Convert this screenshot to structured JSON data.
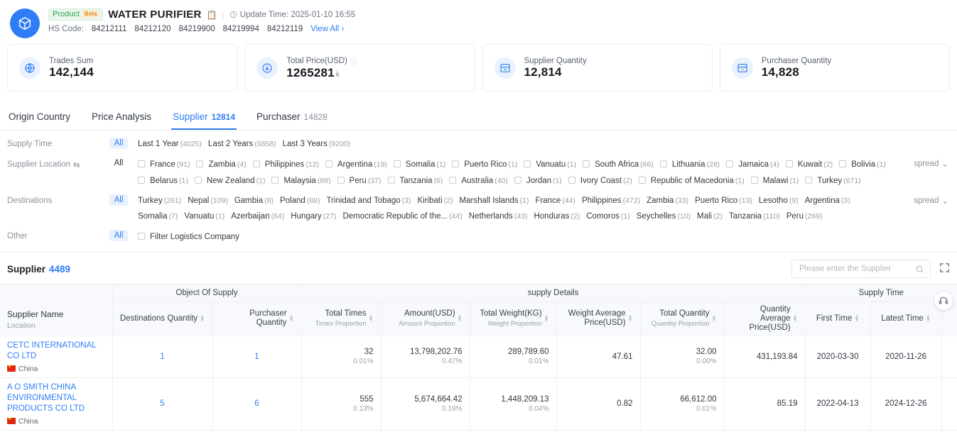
{
  "header": {
    "badge_product": "Product",
    "badge_beta": "Beta",
    "title": "WATER PURIFIER",
    "copy_icon": "copy-icon",
    "update_label": "Update Time: 2025-01-10 16:55",
    "hs_label": "HS Code:",
    "hs_codes": [
      "84212111",
      "84212120",
      "84219900",
      "84219994",
      "84212119"
    ],
    "view_all": "View All"
  },
  "cards": [
    {
      "label": "Trades Sum",
      "value": "142,144",
      "unit": "",
      "info": false,
      "icon": "globe-icon"
    },
    {
      "label": "Total Price(USD)",
      "value": "1265281",
      "unit": "k",
      "info": true,
      "icon": "coin-down-icon"
    },
    {
      "label": "Supplier Quantity",
      "value": "12,814",
      "unit": "",
      "info": false,
      "icon": "supplier-box-icon"
    },
    {
      "label": "Purchaser Quantity",
      "value": "14,828",
      "unit": "",
      "info": false,
      "icon": "purchaser-box-icon"
    }
  ],
  "tabs": [
    {
      "label": "Origin Country",
      "count": "",
      "active": false
    },
    {
      "label": "Price Analysis",
      "count": "",
      "active": false
    },
    {
      "label": "Supplier",
      "count": "12814",
      "active": true
    },
    {
      "label": "Purchaser",
      "count": "14828",
      "active": false
    }
  ],
  "filters": {
    "all_label": "All",
    "spread_label": "spread",
    "rows": [
      {
        "label": "Supply Time",
        "swap_icon": false,
        "all_active": true,
        "checkbox": false,
        "spread": false,
        "items": [
          {
            "name": "Last 1 Year",
            "count": "4025"
          },
          {
            "name": "Last 2 Years",
            "count": "6858"
          },
          {
            "name": "Last 3 Years",
            "count": "9200"
          }
        ]
      },
      {
        "label": "Supplier Location",
        "swap_icon": true,
        "all_active": false,
        "checkbox": true,
        "spread": true,
        "items": [
          {
            "name": "France",
            "count": "91"
          },
          {
            "name": "Zambia",
            "count": "4"
          },
          {
            "name": "Philippines",
            "count": "12"
          },
          {
            "name": "Argentina",
            "count": "19"
          },
          {
            "name": "Somalia",
            "count": "1"
          },
          {
            "name": "Puerto Rico",
            "count": "1"
          },
          {
            "name": "Vanuatu",
            "count": "1"
          },
          {
            "name": "South Africa",
            "count": "86"
          },
          {
            "name": "Lithuania",
            "count": "28"
          },
          {
            "name": "Jamaica",
            "count": "4"
          },
          {
            "name": "Kuwait",
            "count": "2"
          },
          {
            "name": "Bolivia",
            "count": "1"
          },
          {
            "name": "Belarus",
            "count": "1"
          },
          {
            "name": "New Zealand",
            "count": "1"
          },
          {
            "name": "Malaysia",
            "count": "89"
          },
          {
            "name": "Peru",
            "count": "37"
          },
          {
            "name": "Tanzania",
            "count": "6"
          },
          {
            "name": "Australia",
            "count": "40"
          },
          {
            "name": "Jordan",
            "count": "1"
          },
          {
            "name": "Ivory Coast",
            "count": "2"
          },
          {
            "name": "Republic of Macedonia",
            "count": "1"
          },
          {
            "name": "Malawi",
            "count": "1"
          },
          {
            "name": "Turkey",
            "count": "671"
          }
        ]
      },
      {
        "label": "Destinations",
        "swap_icon": false,
        "all_active": true,
        "checkbox": false,
        "spread": true,
        "items": [
          {
            "name": "Turkey",
            "count": "261"
          },
          {
            "name": "Nepal",
            "count": "109"
          },
          {
            "name": "Gambia",
            "count": "8"
          },
          {
            "name": "Poland",
            "count": "88"
          },
          {
            "name": "Trinidad and Tobago",
            "count": "3"
          },
          {
            "name": "Kiribati",
            "count": "2"
          },
          {
            "name": "Marshall Islands",
            "count": "1"
          },
          {
            "name": "France",
            "count": "44"
          },
          {
            "name": "Philippines",
            "count": "472"
          },
          {
            "name": "Zambia",
            "count": "33"
          },
          {
            "name": "Puerto Rico",
            "count": "13"
          },
          {
            "name": "Lesotho",
            "count": "9"
          },
          {
            "name": "Argentina",
            "count": "3"
          },
          {
            "name": "Somalia",
            "count": "7"
          },
          {
            "name": "Vanuatu",
            "count": "1"
          },
          {
            "name": "Azerbaijan",
            "count": "64"
          },
          {
            "name": "Hungary",
            "count": "27"
          },
          {
            "name": "Democratic Republic of the...",
            "count": "44"
          },
          {
            "name": "Netherlands",
            "count": "43"
          },
          {
            "name": "Honduras",
            "count": "2"
          },
          {
            "name": "Comoros",
            "count": "1"
          },
          {
            "name": "Seychelles",
            "count": "10"
          },
          {
            "name": "Mali",
            "count": "2"
          },
          {
            "name": "Tanzania",
            "count": "110"
          },
          {
            "name": "Peru",
            "count": "269"
          }
        ]
      },
      {
        "label": "Other",
        "swap_icon": false,
        "all_active": true,
        "checkbox": true,
        "spread": false,
        "items": [
          {
            "name": "Filter Logistics Company",
            "count": ""
          }
        ]
      }
    ]
  },
  "supplier_section": {
    "title": "Supplier",
    "count": "4489",
    "search_placeholder": "Please enter the Supplier",
    "search_value": "",
    "search_icon": "search-icon",
    "expand_icon": "expand-icon"
  },
  "table": {
    "groups": [
      {
        "label": "",
        "span": 1
      },
      {
        "label": "Object Of Supply",
        "span": 2
      },
      {
        "label": "supply Details",
        "span": 6
      },
      {
        "label": "Supply Time",
        "span": 2
      }
    ],
    "columns": [
      {
        "title": "Supplier Name",
        "sub": "Location",
        "sortable": false
      },
      {
        "title": "Destinations Quantity",
        "sub": "",
        "sortable": true
      },
      {
        "title": "Purchaser Quantity",
        "sub": "",
        "sortable": true
      },
      {
        "title": "Total Times",
        "sub": "Times Proportion",
        "sortable": true
      },
      {
        "title": "Amount(USD)",
        "sub": "Amount Proportion",
        "sortable": true
      },
      {
        "title": "Total Weight(KG)",
        "sub": "Weight Proportion",
        "sortable": true
      },
      {
        "title": "Weight Average Price(USD)",
        "sub": "",
        "sortable": true
      },
      {
        "title": "Total Quantity",
        "sub": "Quantity Proportion",
        "sortable": true
      },
      {
        "title": "Quantity Average Price(USD)",
        "sub": "",
        "sortable": true
      },
      {
        "title": "First Time",
        "sub": "",
        "sortable": true
      },
      {
        "title": "Latest Time",
        "sub": "",
        "sortable": true
      }
    ],
    "rows": [
      {
        "supplier_name": "CETC INTERNATIONAL CO LTD",
        "location": "China",
        "destinations_quantity": "1",
        "purchaser_quantity": "1",
        "total_times": "32",
        "times_proportion": "0.01%",
        "amount_usd": "13,798,202.76",
        "amount_proportion": "0.47%",
        "total_weight_kg": "289,789.60",
        "weight_proportion": "0.01%",
        "weight_average_price": "47.61",
        "total_quantity": "32.00",
        "quantity_proportion": "0.00%",
        "quantity_average_price": "431,193.84",
        "first_time": "2020-03-30",
        "latest_time": "2020-11-26"
      },
      {
        "supplier_name": "A O SMITH CHINA ENVIRONMENTAL PRODUCTS CO LTD",
        "location": "China",
        "destinations_quantity": "5",
        "purchaser_quantity": "6",
        "total_times": "555",
        "times_proportion": "0.13%",
        "amount_usd": "5,674,664.42",
        "amount_proportion": "0.19%",
        "total_weight_kg": "1,448,209.13",
        "weight_proportion": "0.04%",
        "weight_average_price": "0.82",
        "total_quantity": "66,612.00",
        "quantity_proportion": "0.01%",
        "quantity_average_price": "85.19",
        "first_time": "2022-04-13",
        "latest_time": "2024-12-26"
      }
    ]
  }
}
